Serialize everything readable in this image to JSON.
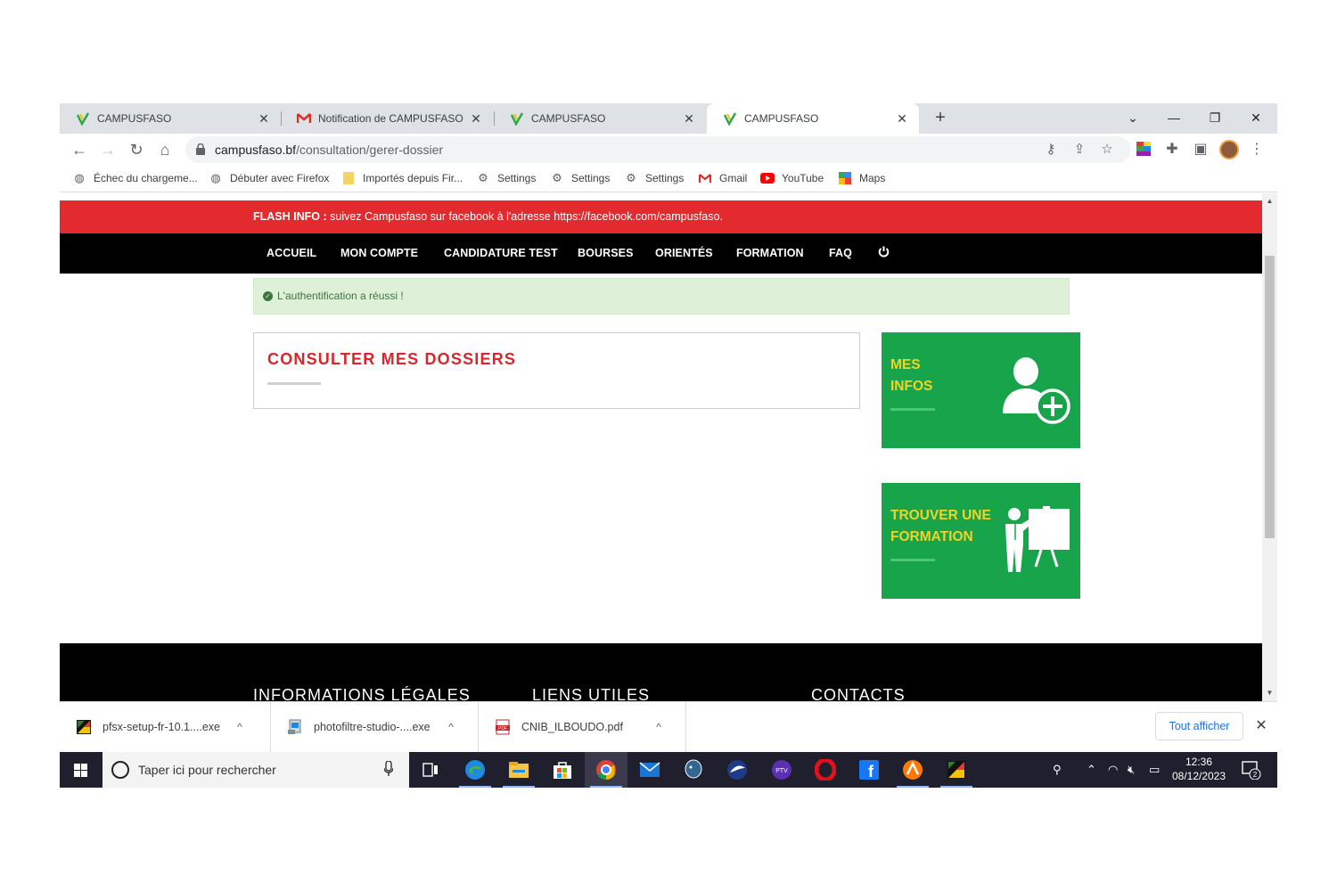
{
  "browser": {
    "tabs": [
      {
        "title": "CAMPUSFASO",
        "icon": "campusfaso-favicon"
      },
      {
        "title": "Notification de CAMPUSFASO - r",
        "icon": "gmail-favicon"
      },
      {
        "title": "CAMPUSFASO",
        "icon": "campusfaso-favicon"
      },
      {
        "title": "CAMPUSFASO",
        "icon": "campusfaso-favicon",
        "active": true
      }
    ],
    "url_host": "campusfaso.bf",
    "url_path": "/consultation/gerer-dossier",
    "bookmarks": [
      {
        "label": "Échec du chargeme...",
        "icon": "globe-icon"
      },
      {
        "label": "Débuter avec Firefox",
        "icon": "globe-icon"
      },
      {
        "label": "Importés depuis Fir...",
        "icon": "folder-icon"
      },
      {
        "label": "Settings",
        "icon": "gear-icon"
      },
      {
        "label": "Settings",
        "icon": "gear-icon"
      },
      {
        "label": "Settings",
        "icon": "gear-icon"
      },
      {
        "label": "Gmail",
        "icon": "gmail-icon"
      },
      {
        "label": "YouTube",
        "icon": "youtube-icon"
      },
      {
        "label": "Maps",
        "icon": "maps-icon"
      }
    ]
  },
  "page": {
    "flash_label": "FLASH INFO :",
    "flash_text": " suivez Campusfaso sur facebook à l'adresse https://facebook.com/campusfaso.",
    "nav": [
      "ACCUEIL",
      "MON COMPTE",
      "CANDIDATURE TEST",
      "BOURSES",
      "ORIENTÉS",
      "FORMATION",
      "FAQ"
    ],
    "alert": "L'authentification a réussi !",
    "panel_title": "CONSULTER MES DOSSIERS",
    "cards": [
      {
        "line1": "MES",
        "line2": "INFOS",
        "icon": "user-add-icon"
      },
      {
        "line1": "TROUVER UNE",
        "line2": "FORMATION",
        "icon": "teacher-board-icon"
      }
    ],
    "footer_headings": [
      "INFORMATIONS LÉGALES",
      "LIENS UTILES",
      "CONTACTS"
    ],
    "colors": {
      "flash": "#e32a2e",
      "nav": "#000000",
      "card": "#17a44a",
      "card_title": "#f2d327",
      "panel_title": "#d9262c"
    }
  },
  "downloads": {
    "items": [
      "pfsx-setup-fr-10.1....exe",
      "photofiltre-studio-....exe",
      "CNIB_ILBOUDO.pdf"
    ],
    "show_all": "Tout afficher"
  },
  "taskbar": {
    "search_placeholder": "Taper ici pour rechercher",
    "time": "12:36",
    "date": "08/12/2023",
    "notifications": "2"
  }
}
